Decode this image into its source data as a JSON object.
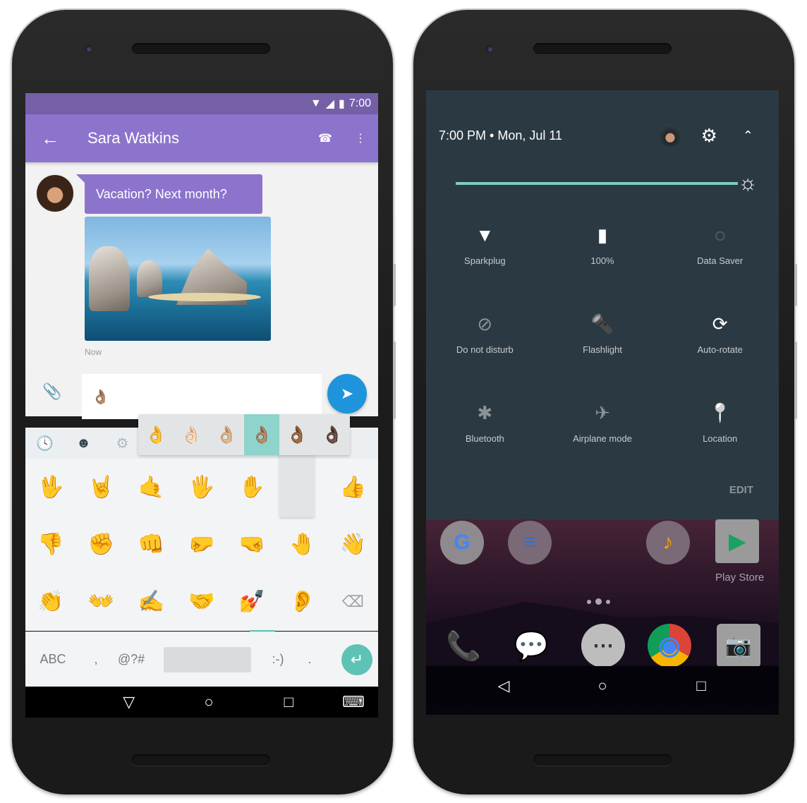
{
  "left_phone": {
    "status_bar": {
      "time": "7:00",
      "icons": [
        "wifi-icon",
        "signal-icon",
        "battery-icon"
      ]
    },
    "app_bar": {
      "title": "Sara Watkins",
      "back_icon": "←",
      "call_icon": "☎",
      "more_icon": "⋮"
    },
    "conversation": {
      "message_text": "Vacation? Next month?",
      "image_description": "Rock arch coastline photo",
      "timestamp": "Now"
    },
    "composer": {
      "attach_icon": "📎",
      "input_value": "👌🏽",
      "send_icon": "➤"
    },
    "emoji_keyboard": {
      "category_tabs": [
        "🕓",
        "☻",
        "⚙"
      ],
      "skin_tone_variants": [
        "👌",
        "👌🏻",
        "👌🏼",
        "👌🏽",
        "👌🏾",
        "👌🏿"
      ],
      "selected_skin_tone_index": 3,
      "emojis": [
        "🖖",
        "🤘",
        "🤙",
        "🖐",
        "✋",
        "",
        "👍",
        "👎",
        "✊",
        "👊",
        "🤛",
        "🤜",
        "🤚",
        "👋",
        "👏",
        "👐",
        "✍",
        "🤝",
        "💅",
        "👂"
      ],
      "delete_icon": "⌫",
      "bottom_row": {
        "abc": "ABC",
        "comma": ",",
        "symbols": "@?#",
        "emoticon": ":-)",
        "period": ".",
        "enter_icon": "↵"
      }
    },
    "nav_bar": {
      "back": "▽",
      "home": "○",
      "recents": "□",
      "keyboard": "⌨"
    }
  },
  "right_phone": {
    "quick_settings": {
      "datetime": "7:00 PM • Mon, Jul 11",
      "settings_icon": "⚙",
      "collapse_icon": "⌃",
      "brightness_level": 1.0,
      "brightness_icon": "☼",
      "tiles": [
        {
          "label": "Sparkplug",
          "icon": "▼",
          "active": true
        },
        {
          "label": "100%",
          "icon": "▮",
          "active": true
        },
        {
          "label": "Data Saver",
          "icon": "◌",
          "active": false
        },
        {
          "label": "Do not disturb",
          "icon": "⊘",
          "active": false
        },
        {
          "label": "Flashlight",
          "icon": "🔦",
          "active": false
        },
        {
          "label": "Auto-rotate",
          "icon": "⟳",
          "active": true
        },
        {
          "label": "Bluetooth",
          "icon": "✱",
          "active": false
        },
        {
          "label": "Airplane mode",
          "icon": "✈",
          "active": false
        },
        {
          "label": "Location",
          "icon": "📍",
          "active": true
        }
      ],
      "edit_label": "EDIT"
    },
    "home_screen": {
      "top_apps": [
        "G",
        "≡",
        "♪",
        "▶"
      ],
      "play_store_label": "Play Store",
      "dock_apps": [
        "📞",
        "💬",
        "⋯",
        "◉",
        "📷"
      ]
    },
    "nav_bar": {
      "back": "◁",
      "home": "○",
      "recents": "□"
    }
  }
}
